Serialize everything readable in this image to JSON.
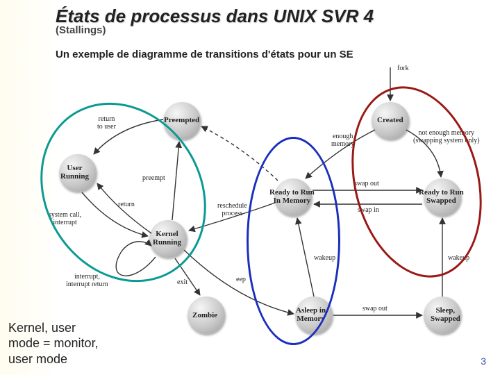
{
  "title": "États de processus dans UNIX SVR 4",
  "source": "(Stallings)",
  "description": "Un exemple de diagramme de transitions d'états pour un SE",
  "annotation": "Kernel, user\nmode = monitor,\nuser mode",
  "pageNumber": "3",
  "nodes": {
    "userRunning": {
      "label": "User\nRunning"
    },
    "kernelRunning": {
      "label": "Kernel\nRunning"
    },
    "preempted": {
      "label": "Preempted"
    },
    "zombie": {
      "label": "Zombie"
    },
    "asleepMem": {
      "label": "Asleep in\nMemory"
    },
    "readyMem": {
      "label": "Ready to Run\nIn Memory"
    },
    "created": {
      "label": "Created"
    },
    "readySwap": {
      "label": "Ready to Run\nSwapped"
    },
    "sleepSwap": {
      "label": "Sleep,\nSwapped"
    }
  },
  "edges": {
    "fork": "fork",
    "enoughMemory": "enough\nmemory",
    "notEnoughMemory": "not enough memory\n(swapping system only)",
    "swapOut1": "swap out",
    "swapIn": "swap in",
    "swapOut2": "swap out",
    "wakeup1": "wakeup",
    "wakeup2": "wakeup",
    "sleep": "eep",
    "reschedule": "reschedule\nprocess",
    "return": "return",
    "preemptEdge": "preempt",
    "returnToUser": "return\nto user",
    "syscall": "system call,\ninterrupt",
    "interruptReturn": "interrupt,\ninterrupt return",
    "exit": "exit"
  }
}
